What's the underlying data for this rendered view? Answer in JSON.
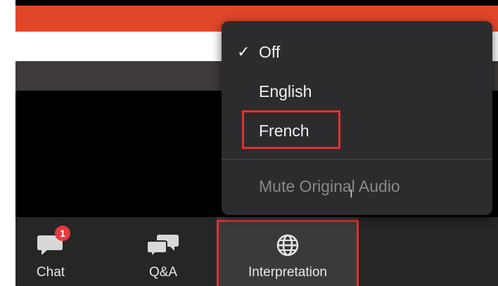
{
  "menu": {
    "items": [
      {
        "label": "Off",
        "checked": true
      },
      {
        "label": "English",
        "checked": false
      },
      {
        "label": "French",
        "checked": false,
        "highlighted": true
      }
    ],
    "check_glyph": "✓",
    "mute_label": "Mute Original Audio",
    "mute_enabled": false
  },
  "toolbar": {
    "chat": {
      "label": "Chat",
      "badge": "1",
      "icon": "chat-icon"
    },
    "qa": {
      "label": "Q&A",
      "icon": "qa-icon"
    },
    "interpretation": {
      "label": "Interpretation",
      "icon": "globe-icon",
      "highlighted": true
    }
  },
  "colors": {
    "accent_orange": "#e0472a",
    "highlight_red": "#e0322e",
    "badge_red": "#e8383d",
    "menu_bg": "#2c2c2e",
    "toolbar_bg": "#262626"
  }
}
